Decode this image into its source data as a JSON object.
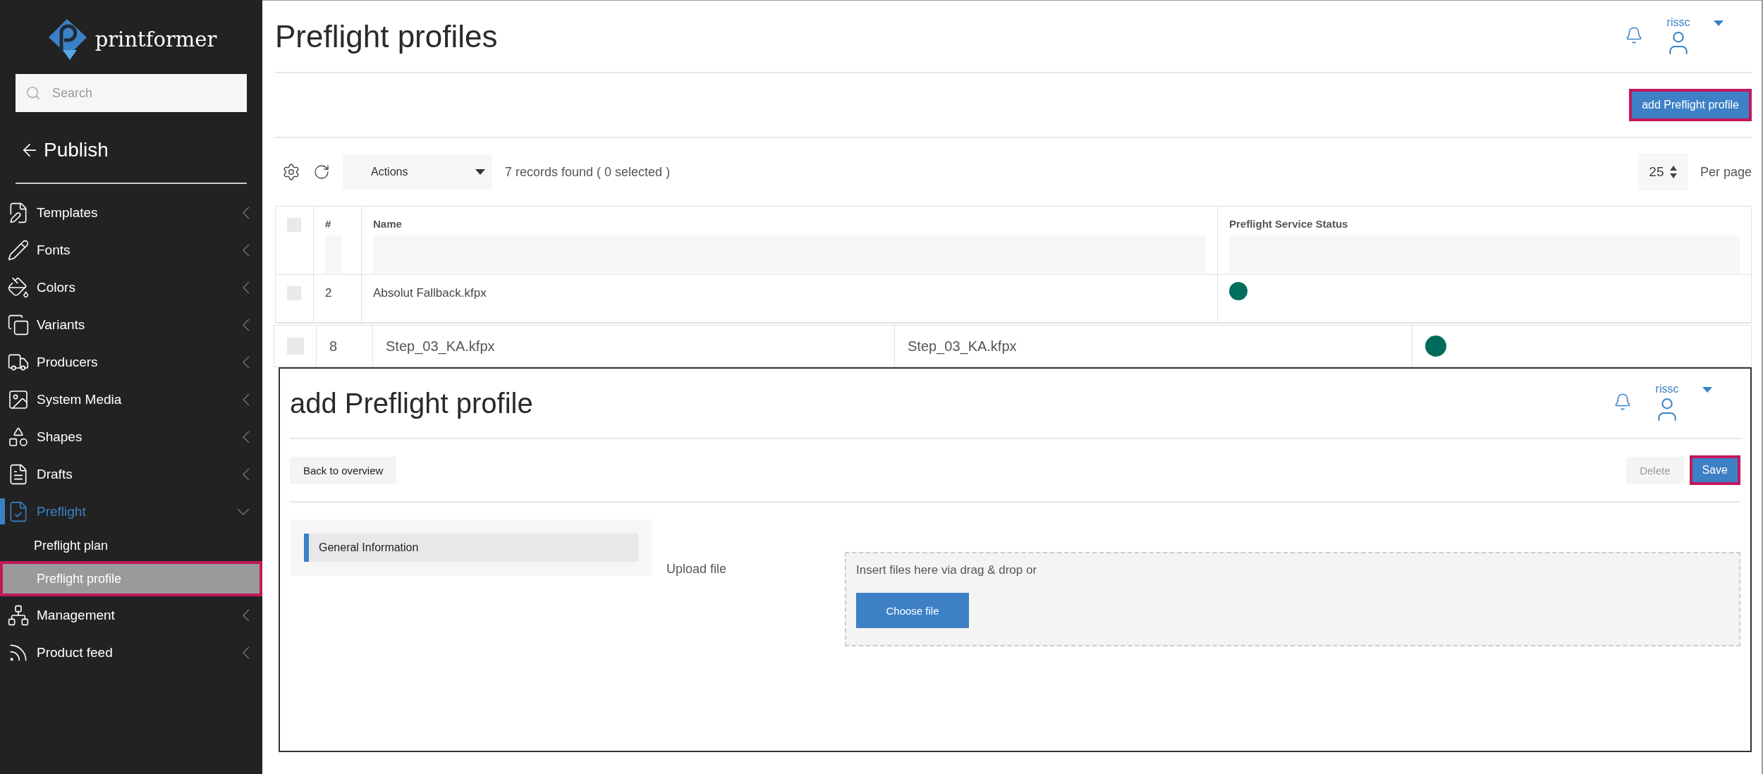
{
  "sidebar": {
    "logo": "printformer",
    "search": {
      "placeholder": "Search"
    },
    "back": "Publish",
    "items": [
      {
        "label": "Templates",
        "expanded": false,
        "selected": false
      },
      {
        "label": "Fonts",
        "expanded": false,
        "selected": false
      },
      {
        "label": "Colors",
        "expanded": false,
        "selected": false
      },
      {
        "label": "Variants",
        "expanded": false,
        "selected": false
      },
      {
        "label": "Producers",
        "expanded": false,
        "selected": false
      },
      {
        "label": "System Media",
        "expanded": false,
        "selected": false
      },
      {
        "label": "Shapes",
        "expanded": false,
        "selected": false
      },
      {
        "label": "Drafts",
        "expanded": false,
        "selected": false
      },
      {
        "label": "Preflight",
        "expanded": true,
        "selected": true,
        "children": [
          {
            "label": "Preflight plan",
            "selected": false,
            "highlighted": false
          },
          {
            "label": "Preflight profile",
            "selected": true,
            "highlighted": true
          }
        ]
      },
      {
        "label": "Management",
        "expanded": false,
        "selected": false
      },
      {
        "label": "Product feed",
        "expanded": false,
        "selected": false
      }
    ]
  },
  "header": {
    "title": "Preflight profiles",
    "user": "rissc"
  },
  "add_button": {
    "label": "add Preflight profile",
    "highlighted": true
  },
  "toolbar": {
    "actions": "Actions",
    "records": "7 records found ( 0 selected )",
    "per_page_value": "25",
    "per_page_label": "Per page"
  },
  "table": {
    "select_all_checked": false,
    "columns": [
      "#",
      "Name",
      "Preflight Service Status"
    ],
    "rows": [
      {
        "checked": false,
        "id": "2",
        "name": "Absolut Fallback.kfpx",
        "color": "#006e5f"
      }
    ]
  },
  "overlay_row": {
    "checked": false,
    "id": "8",
    "cells": [
      "Step_03_KA.kfpx",
      "Step_03_KA.kfpx"
    ],
    "color": "#006b5a"
  },
  "form": {
    "title": "add Preflight profile",
    "user": "rissc",
    "back": "Back to overview",
    "delete": {
      "label": "Delete",
      "disabled": true
    },
    "save": {
      "label": "Save",
      "highlighted": true
    },
    "tabs": [
      {
        "label": "General Information",
        "selected": true
      }
    ],
    "upload_label": "Upload file",
    "drop_text": "Insert files here via drag & drop or",
    "choose": "Choose file"
  }
}
